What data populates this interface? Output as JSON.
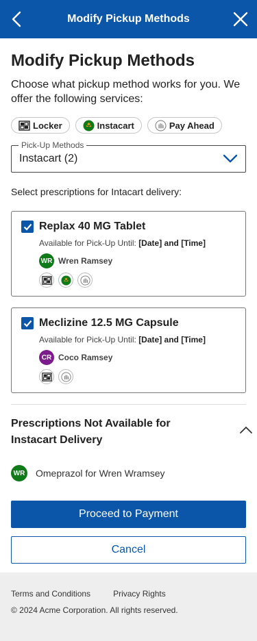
{
  "header": {
    "title": "Modify Pickup Methods",
    "back_icon": "chevron-left-icon",
    "close_icon": "close-icon"
  },
  "page": {
    "title": "Modify Pickup Methods",
    "intro": "Choose what pickup method works for you. We offer the following services:"
  },
  "chips": [
    {
      "label": "Locker",
      "icon": "locker-icon"
    },
    {
      "label": "Instacart",
      "icon": "instacart-icon"
    },
    {
      "label": "Pay Ahead",
      "icon": "pay-ahead-icon"
    }
  ],
  "select": {
    "legend": "Pick-Up Methods",
    "value": "Instacart (2)"
  },
  "instruction": "Select prescriptions for Intacart delivery:",
  "prescriptions": [
    {
      "name": "Replax 40 MG Tablet",
      "avail_label": "Available for Pick-Up Until:",
      "avail_value": "[Date] and [Time]",
      "initials": "WR",
      "person": "Wren Ramsey",
      "checked": true
    },
    {
      "name": "Meclizine 12.5 MG Capsule",
      "avail_label": "Available for Pick-Up Until:",
      "avail_value": "[Date] and [Time]",
      "initials": "CR",
      "person": "Coco Ramsey",
      "checked": true
    }
  ],
  "not_available": {
    "title": "Prescriptions Not Available for Instacart Delivery",
    "items": [
      {
        "initials": "WR",
        "label": "Omeprazol for Wren Wramsey"
      }
    ]
  },
  "buttons": {
    "proceed": "Proceed to Payment",
    "cancel": "Cancel"
  },
  "footer": {
    "terms": "Terms and Conditions",
    "privacy": "Privacy Rights",
    "copyright": "© 2024 Acme Corporation. All rights reserved."
  },
  "colors": {
    "brand": "#0b56a8",
    "avatar_green": "#0e7a18",
    "avatar_purple": "#7c1c8c"
  }
}
